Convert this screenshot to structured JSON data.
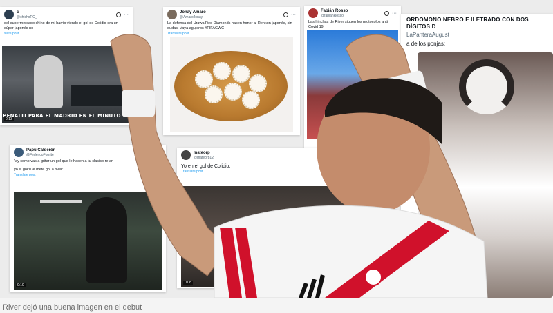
{
  "tweets": [
    {
      "user": "c",
      "handle": "@chichoRC_",
      "text": "del supermercado chino de mi barrio viendo el gol de Colidio era un súper japonés no",
      "translate": "slate post",
      "video_caption": "PENALTI PARA EL MADRID EN EL MINUTO 93",
      "video_time": "0:13"
    },
    {
      "user": "Jonay Amaro",
      "handle": "@AmaroJonay",
      "text": "La defensa del Urawa Red Diamonds hacen honor al Renkon japonés, sin dudas. Vaya agujeros #FIFACWC",
      "translate": "Translate post"
    },
    {
      "user": "Fabián Rosso",
      "handle": "@fabianRosso",
      "text": "Las hinchas de River siguen los protocolos anti Covid 19"
    },
    {
      "title": "ORDOMONO NEBRO E ILETRADO CON DOS DÍGITOS D",
      "handle": "LaPanteraAugust",
      "text": "a de los ponjas:"
    },
    {
      "user": "Papu Calderón",
      "handle": "@FedericoFomite",
      "text": "\"ay como vas a gritar un gol que le hacen a tu clasico re an",
      "text2": "yo si goku le mete gol a river:",
      "translate": "Translate post",
      "video_time": "0:10"
    },
    {
      "user": "mateorp",
      "handle": "@mateorp12_",
      "text": "Yo en el gol de Colidio:",
      "translate": "Translate post",
      "video_time": "0:08"
    }
  ],
  "caption": "River dejó una buena imagen en el debut",
  "colors": {
    "river_red": "#d0112b",
    "link_blue": "#1d9bf0"
  },
  "icons": [
    "x-logo-icon",
    "more-dots-icon"
  ]
}
